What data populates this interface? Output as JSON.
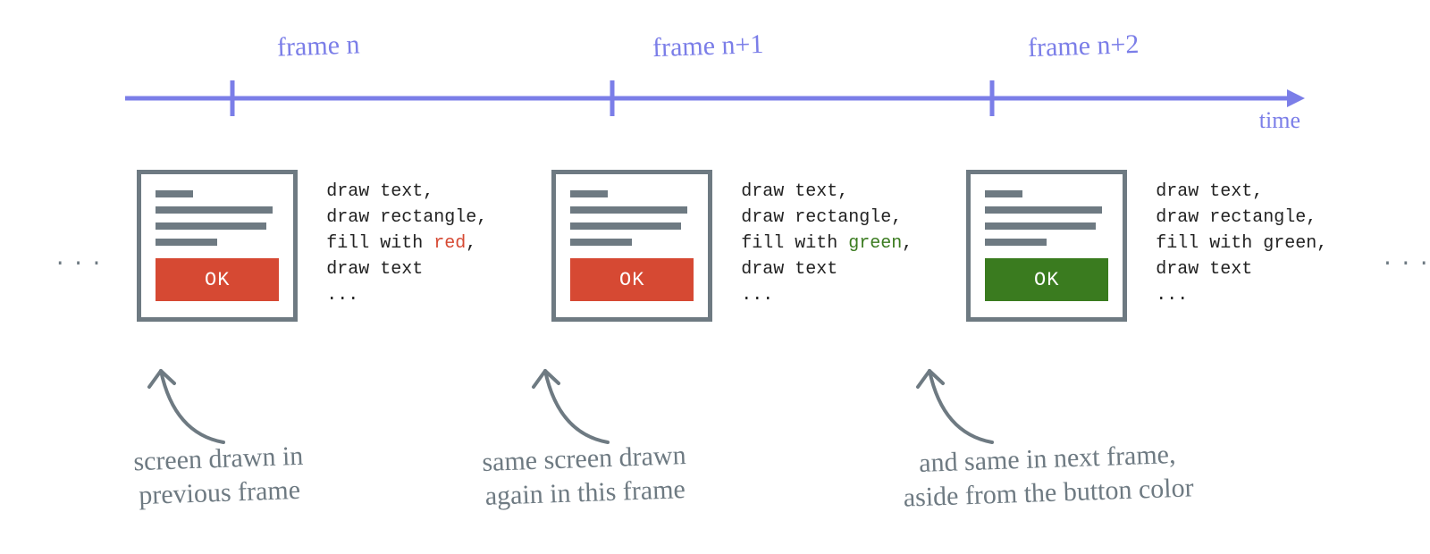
{
  "timeline": {
    "frame_n": "frame n",
    "frame_n1": "frame n+1",
    "frame_n2": "frame n+2",
    "time_label": "time"
  },
  "ui": {
    "ellipsis": "...",
    "ok_label": "OK"
  },
  "code": {
    "line1": "draw text,",
    "line2": "draw rectangle,",
    "fill_prefix": "fill with ",
    "comma": ",",
    "line4": "draw text",
    "line5": "...",
    "red": "red",
    "green": "green",
    "green_plain": "green"
  },
  "annotations": {
    "a1_l1": "screen drawn in",
    "a1_l2": "previous frame",
    "a2_l1": "same screen drawn",
    "a2_l2": "again in this frame",
    "a3_l1": "and same in next frame,",
    "a3_l2": "aside from the button color"
  },
  "colors": {
    "purple": "#7b7ee8",
    "gray": "#6e7a82",
    "red": "#d64933",
    "green": "#3a7b1f"
  }
}
